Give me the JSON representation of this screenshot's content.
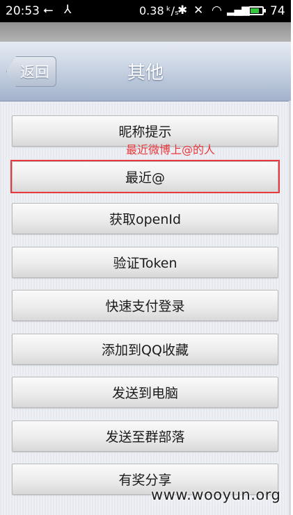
{
  "status_bar": {
    "time": "20:53",
    "usb_icon": "usb-icon",
    "pin_icon": "pin-icon",
    "net_speed": "0.38 ᵏ/ₛ",
    "battery_level": "74",
    "battery_fraction": 0.74,
    "battery_color": "#35c53e"
  },
  "header": {
    "back_label": "返回",
    "title": "其他"
  },
  "menu": {
    "items": [
      {
        "label": "昵称提示"
      },
      {
        "label": "最近@"
      },
      {
        "label": "获取openId"
      },
      {
        "label": "验证Token"
      },
      {
        "label": "快速支付登录"
      },
      {
        "label": "添加到QQ收藏"
      },
      {
        "label": "发送到电脑"
      },
      {
        "label": "发送至群部落"
      },
      {
        "label": "有奖分享"
      }
    ]
  },
  "annotation": {
    "text": "最近微博上@的人",
    "color": "#e8383b"
  },
  "watermark": "www.wooyun.org"
}
